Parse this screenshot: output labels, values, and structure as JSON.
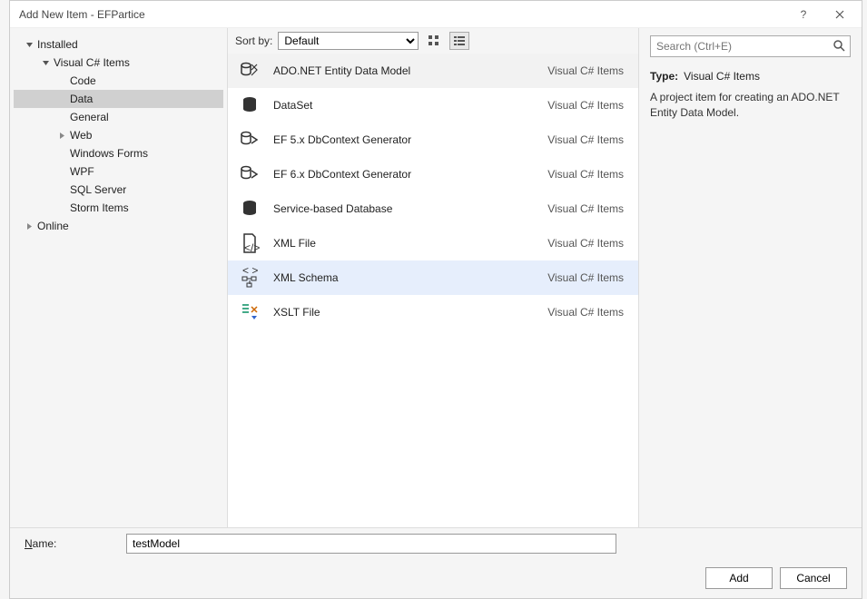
{
  "title": "Add New Item - EFPartice",
  "tree": {
    "installed": "Installed",
    "visual_csharp": "Visual C# Items",
    "code": "Code",
    "data": "Data",
    "general": "General",
    "web": "Web",
    "windows_forms": "Windows Forms",
    "wpf": "WPF",
    "sql_server": "SQL Server",
    "storm": "Storm Items",
    "online": "Online"
  },
  "toolbar": {
    "sort_label": "Sort by:",
    "sort_value": "Default"
  },
  "items": [
    {
      "name": "ADO.NET Entity Data Model",
      "cat": "Visual C# Items"
    },
    {
      "name": "DataSet",
      "cat": "Visual C# Items"
    },
    {
      "name": "EF 5.x DbContext Generator",
      "cat": "Visual C# Items"
    },
    {
      "name": "EF 6.x DbContext Generator",
      "cat": "Visual C# Items"
    },
    {
      "name": "Service-based Database",
      "cat": "Visual C# Items"
    },
    {
      "name": "XML File",
      "cat": "Visual C# Items"
    },
    {
      "name": "XML Schema",
      "cat": "Visual C# Items"
    },
    {
      "name": "XSLT File",
      "cat": "Visual C# Items"
    }
  ],
  "search": {
    "placeholder": "Search (Ctrl+E)"
  },
  "detail": {
    "type_label": "Type:",
    "type_value": "Visual C# Items",
    "description": "A project item for creating an ADO.NET Entity Data Model."
  },
  "name_row": {
    "label": "Name:",
    "value": "testModel"
  },
  "buttons": {
    "add": "Add",
    "cancel": "Cancel"
  }
}
